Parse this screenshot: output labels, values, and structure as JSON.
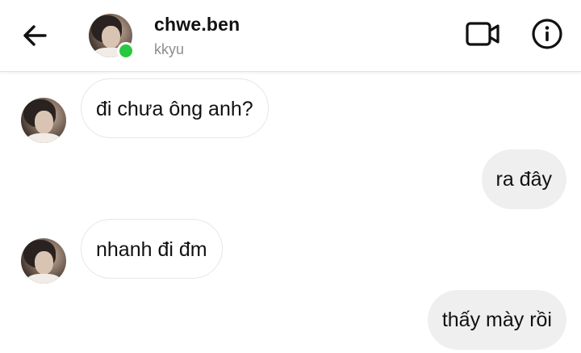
{
  "header": {
    "name": "chwe.ben",
    "subtitle": "kkyu",
    "back_icon": "arrow-left-icon",
    "video_icon": "video-camera-icon",
    "info_icon": "info-circle-icon",
    "online_color": "#28c840"
  },
  "messages": [
    {
      "direction": "incoming",
      "text": "đi chưa ông anh?"
    },
    {
      "direction": "outgoing",
      "text": "ra đây"
    },
    {
      "direction": "incoming",
      "text": "nhanh đi đm"
    },
    {
      "direction": "outgoing",
      "text": "thấy mày rồi"
    }
  ],
  "colors": {
    "incoming_bubble": "#ffffff",
    "outgoing_bubble": "#efefef",
    "text": "#111111",
    "subtitle": "#8e8e8e"
  }
}
